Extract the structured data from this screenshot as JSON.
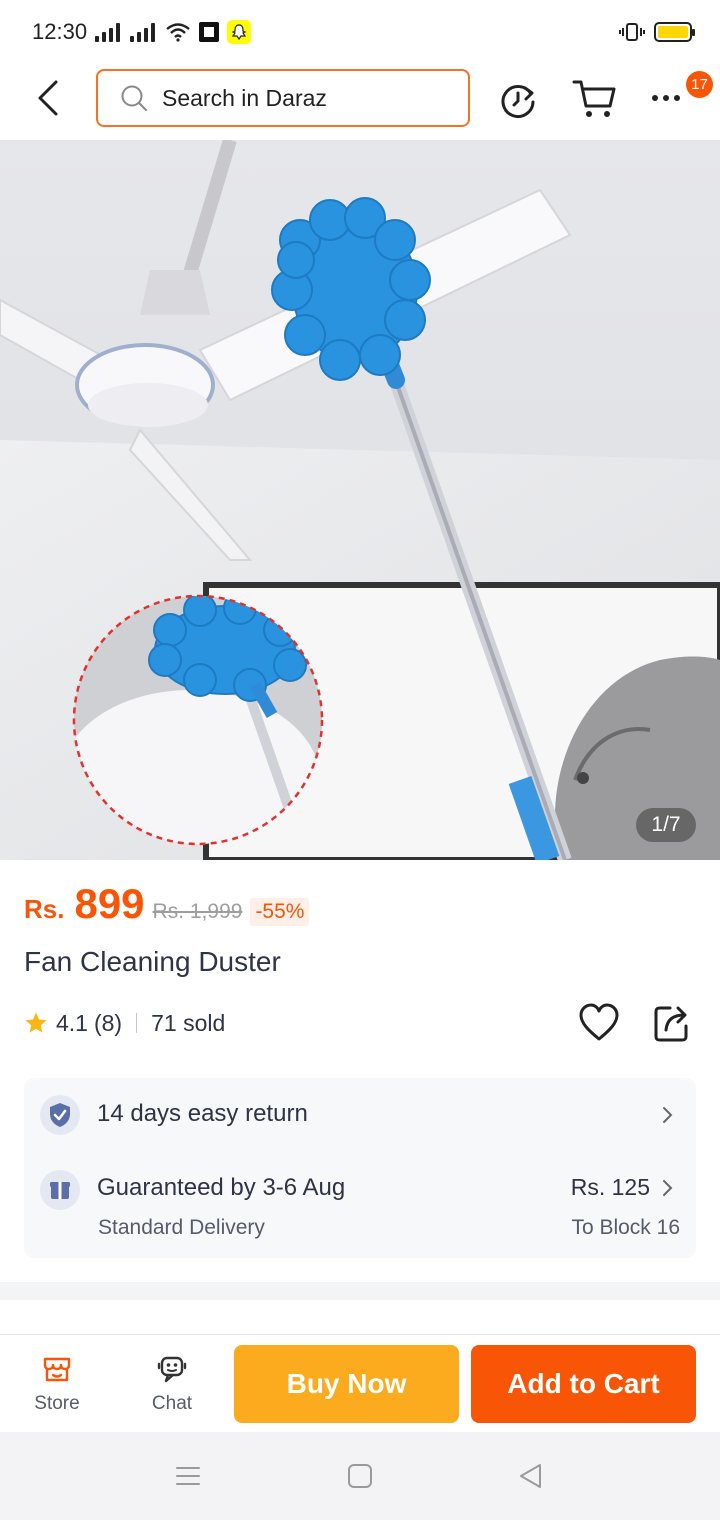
{
  "status_bar": {
    "time": "12:30",
    "icons": [
      "signal-icon",
      "signal-icon",
      "wifi-icon",
      "qr-app-icon",
      "snapchat-icon",
      "vibrate-icon",
      "battery-icon"
    ]
  },
  "header": {
    "search_placeholder": "Search in Daraz",
    "cart_badge": "17",
    "accent_color": "#f57224"
  },
  "gallery": {
    "counter": "1/7"
  },
  "product": {
    "currency": "Rs.",
    "price": "899",
    "original_price": "Rs. 1,999",
    "discount": "-55%",
    "title": "Fan Cleaning Duster",
    "rating": "4.1",
    "rating_count": "(8)",
    "sold": "71 sold"
  },
  "services": {
    "return_text": "14 days easy return",
    "delivery_guarantee": "Guaranteed by 3-6 Aug",
    "delivery_type": "Standard Delivery",
    "delivery_fee": "Rs. 125",
    "delivery_location": "To Block 16"
  },
  "action_bar": {
    "store_label": "Store",
    "chat_label": "Chat",
    "buy_now_label": "Buy Now",
    "add_to_cart_label": "Add to Cart",
    "buy_color": "#fcab1e",
    "cart_color": "#f85606"
  }
}
